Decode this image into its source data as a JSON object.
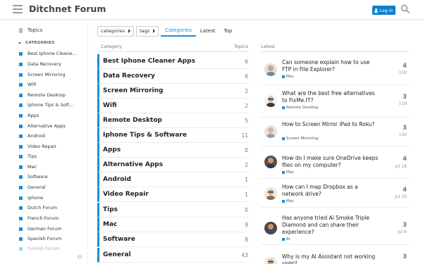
{
  "header": {
    "title": "Ditchnet Forum",
    "login_label": "Log In"
  },
  "sidebar": {
    "topics_label": "Topics",
    "section_label": "CATEGORIES",
    "categories": [
      "Best Iphone Cleane...",
      "Data Recovery",
      "Screen Mirroring",
      "Wifi",
      "Remote Desktop",
      "Iphone Tips & Soft...",
      "Apps",
      "Alternative Apps",
      "Android",
      "Video Repair",
      "Tips",
      "Mac",
      "Software",
      "General",
      "Iphone",
      "Dutch Forum",
      "French Forum",
      "German Forum",
      "Spanish Forum",
      "Turkish Forum"
    ]
  },
  "nav": {
    "categories_dd": "categories",
    "tags_dd": "tags",
    "tabs": [
      "Categories",
      "Latest",
      "Top"
    ]
  },
  "table": {
    "col_category": "Category",
    "col_topics": "Topics",
    "col_latest": "Latest",
    "rows": [
      {
        "name": "Best Iphone Cleaner Apps",
        "count": "6"
      },
      {
        "name": "Data Recovery",
        "count": "6"
      },
      {
        "name": "Screen Mirroring",
        "count": "2"
      },
      {
        "name": "Wifi",
        "count": "2"
      },
      {
        "name": "Remote Desktop",
        "count": "5"
      },
      {
        "name": "Iphone Tips & Software",
        "count": "11"
      },
      {
        "name": "Apps",
        "count": "0"
      },
      {
        "name": "Alternative Apps",
        "count": "2"
      },
      {
        "name": "Android",
        "count": "1"
      },
      {
        "name": "Video Repair",
        "count": "1"
      },
      {
        "name": "Tips",
        "count": "0"
      },
      {
        "name": "Mac",
        "count": "9"
      },
      {
        "name": "Software",
        "count": "8"
      },
      {
        "name": "General",
        "count": "43"
      }
    ]
  },
  "latest": [
    {
      "title": "Can someone explain how to use FTP in File Explorer?",
      "tag": "Mac",
      "count": "4",
      "date": "10d"
    },
    {
      "title": "What are the best free alternatives to FixMe.IT?",
      "tag": "Remote Desktop",
      "count": "3",
      "date": "11d"
    },
    {
      "title": "How to Screen Mirror iPad to Roku?",
      "tag": "Screen Mirroring",
      "count": "3",
      "date": "15d"
    },
    {
      "title": "How do I make sure OneDrive keeps files on my computer?",
      "tag": "Mac",
      "count": "4",
      "date": "Jul 18"
    },
    {
      "title": "How can I map Dropbox as a network drive?",
      "tag": "Mac",
      "count": "4",
      "date": "Jul 16"
    },
    {
      "title": "Has anyone tried Ai Smoke Triple Diamond and can share their experience?",
      "tag": "Ai",
      "count": "3",
      "date": "Jul 6"
    },
    {
      "title": "Why is my AI Assistant not working right?",
      "tag": "",
      "count": "3",
      "date": ""
    }
  ],
  "colors": {
    "accent": "#1a8fd8",
    "login": "#0a7fcf"
  }
}
